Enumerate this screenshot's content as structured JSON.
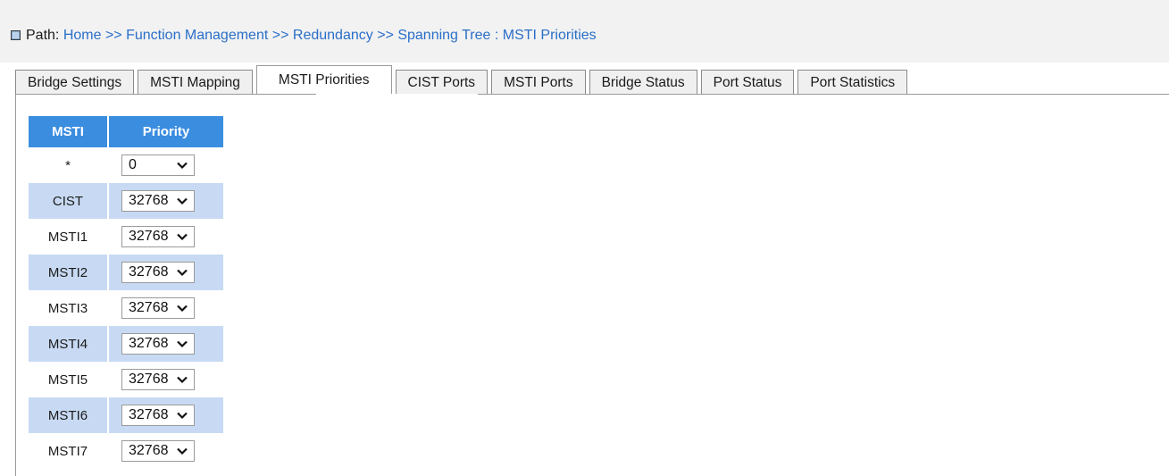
{
  "path": {
    "label": "Path:",
    "crumbs": [
      "Home",
      "Function Management",
      "Redundancy",
      "Spanning Tree : MSTI Priorities"
    ],
    "separator": ">>"
  },
  "tabs": [
    {
      "label": "Bridge Settings",
      "active": false
    },
    {
      "label": "MSTI Mapping",
      "active": false
    },
    {
      "label": "MSTI Priorities",
      "active": true
    },
    {
      "label": "CIST Ports",
      "active": false
    },
    {
      "label": "MSTI Ports",
      "active": false
    },
    {
      "label": "Bridge Status",
      "active": false
    },
    {
      "label": "Port Status",
      "active": false
    },
    {
      "label": "Port Statistics",
      "active": false
    }
  ],
  "table": {
    "headers": [
      "MSTI",
      "Priority"
    ],
    "rows": [
      {
        "msti": "*",
        "priority": "0"
      },
      {
        "msti": "CIST",
        "priority": "32768"
      },
      {
        "msti": "MSTI1",
        "priority": "32768"
      },
      {
        "msti": "MSTI2",
        "priority": "32768"
      },
      {
        "msti": "MSTI3",
        "priority": "32768"
      },
      {
        "msti": "MSTI4",
        "priority": "32768"
      },
      {
        "msti": "MSTI5",
        "priority": "32768"
      },
      {
        "msti": "MSTI6",
        "priority": "32768"
      },
      {
        "msti": "MSTI7",
        "priority": "32768"
      }
    ]
  },
  "colors": {
    "header_bg": "#3b8de0",
    "row_stripe": "#c8daf3",
    "link": "#2a6fc9"
  },
  "icons": {
    "path_marker": "square-bullet-icon",
    "select_arrow": "chevron-down-icon"
  }
}
